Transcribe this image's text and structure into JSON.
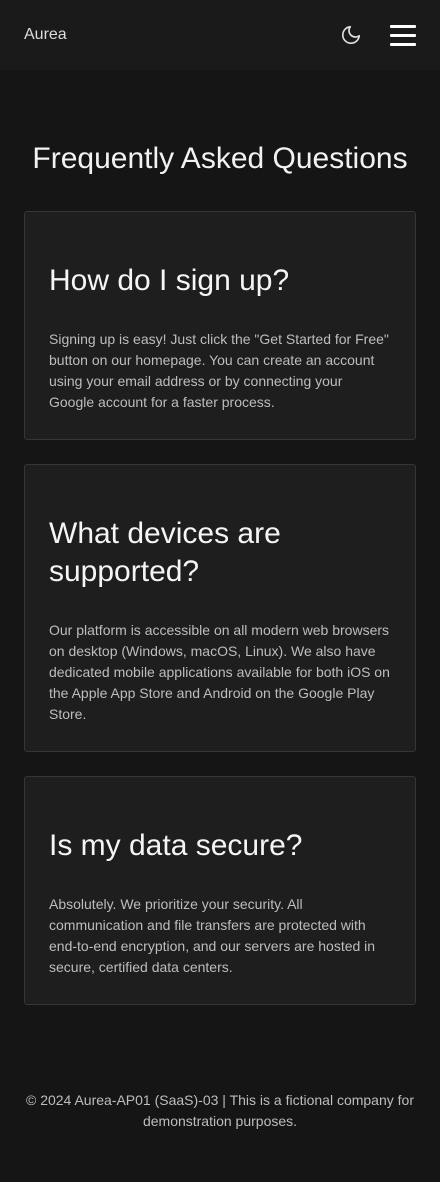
{
  "header": {
    "brand": "Aurea",
    "theme_icon": "moon-icon",
    "menu_icon": "hamburger-menu-icon"
  },
  "main": {
    "title": "Frequently Asked Questions",
    "faqs": [
      {
        "question": "How do I sign up?",
        "answer": "Signing up is easy! Just click the \"Get Started for Free\" button on our homepage. You can create an account using your email address or by connecting your Google account for a faster process."
      },
      {
        "question": "What devices are supported?",
        "answer": "Our platform is accessible on all modern web browsers on desktop (Windows, macOS, Linux). We also have dedicated mobile applications available for both iOS on the Apple App Store and Android on the Google Play Store."
      },
      {
        "question": "Is my data secure?",
        "answer": "Absolutely. We prioritize your security. All communication and file transfers are protected with end-to-end encryption, and our servers are hosted in secure, certified data centers."
      }
    ]
  },
  "footer": {
    "text": "© 2024 Aurea-AP01 (SaaS)-03 | This is a fictional company for demonstration purposes."
  },
  "colors": {
    "background": "#151515",
    "header": "#1a1a1a",
    "card": "#1e1e1e",
    "card_border": "#363636"
  }
}
